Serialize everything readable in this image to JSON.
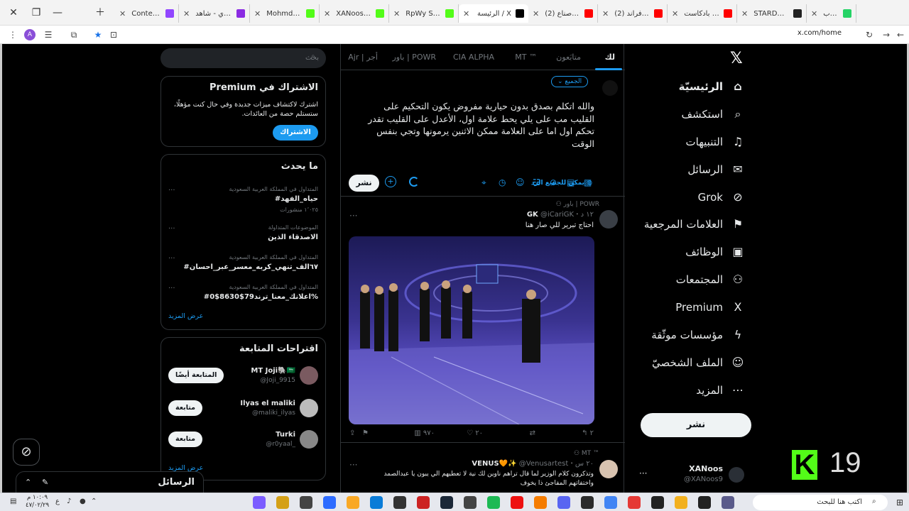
{
  "browser": {
    "tabs": [
      {
        "label": "واتساب",
        "color": "#25d366"
      },
      {
        "label": "STARDOM UN",
        "color": "#222222"
      },
      {
        "label": "للي بادكاست",
        "color": "#ff0000"
      },
      {
        "label": "(2) اغنية فراند",
        "color": "#ff0000"
      },
      {
        "label": "(2) دوري صناع",
        "color": "#ff0000"
      },
      {
        "label": "الرئيسة / X",
        "color": "#000000"
      },
      {
        "label": "RpWy Stream",
        "color": "#53fc18"
      },
      {
        "label": "XANoos Strea",
        "color": "#53fc18"
      },
      {
        "label": "Mohmdi12 Str",
        "color": "#53fc18"
      },
      {
        "label": "نوريلاي - شاهد",
        "color": "#8a2be2"
      },
      {
        "label": "ContentCreato",
        "color": "#9146ff"
      }
    ],
    "url": "x.com/home",
    "profile_letter": "A"
  },
  "sidebar": {
    "items": [
      {
        "label": "الرئيسيّة",
        "icon": "home-icon",
        "glyph": "⌂"
      },
      {
        "label": "استكشف",
        "icon": "search-icon",
        "glyph": "⌕"
      },
      {
        "label": "التنبيهات",
        "icon": "bell-icon",
        "glyph": "♫"
      },
      {
        "label": "الرسائل",
        "icon": "mail-icon",
        "glyph": "✉"
      },
      {
        "label": "Grok",
        "icon": "grok-icon",
        "glyph": "⊘"
      },
      {
        "label": "العلامات المرجعية",
        "icon": "bookmark-icon",
        "glyph": "⚑"
      },
      {
        "label": "الوظائف",
        "icon": "briefcase-icon",
        "glyph": "▣"
      },
      {
        "label": "المجتمعات",
        "icon": "communities-icon",
        "glyph": "⚇"
      },
      {
        "label": "Premium",
        "icon": "x-logo-icon",
        "glyph": "X"
      },
      {
        "label": "مؤسسات موثّقة",
        "icon": "lightning-icon",
        "glyph": "ϟ"
      },
      {
        "label": "الملف الشخصيّ",
        "icon": "person-icon",
        "glyph": "☺"
      },
      {
        "label": "المزيد",
        "icon": "more-circle-icon",
        "glyph": "⋯"
      }
    ],
    "post_label": "نشر",
    "profile": {
      "name": "XANoos",
      "handle": "@XANoos9"
    }
  },
  "overlay": {
    "kick_letter": "K",
    "kick_number": "19"
  },
  "timeline": {
    "tabs": [
      "لك",
      "متابَعون",
      "MT ™",
      "CIA ALPHA",
      "باور | POWR",
      "Ajr | أجر"
    ],
    "composer": {
      "audience": "الجميع",
      "text": "والله اتكلم بصدق بدون حيارية مفروض يكون التحكيم على القليب مب على يلي يحط علامة اول، الأعدل على القليب تقدر تحكم اول اما على العلامة ممكن الاثنين يرمونها وتجي بنفس الوقت",
      "reply_setting": "يمكن للجميع الرد",
      "post_label": "نشر"
    },
    "tweets": [
      {
        "community": "باور | POWR",
        "name": "GK",
        "handle": "@iCariGK",
        "time": "١٢ د",
        "text": "احتاج تبرير للي صار هنا",
        "replies": "٢",
        "likes": "٢٠",
        "views": "٩٧٠"
      },
      {
        "community": "MT ™",
        "name": "VENUS🧡✨",
        "handle": "@Venusartest",
        "time": "٢٠ س",
        "line1": "وتذكرون كلام الوزير لما قال تراهم ناوين لك نية لا تعطيهم الي يبون يا عبدالصمد",
        "line2": "واختفاتهم المفاجئ ذا يخوف"
      }
    ]
  },
  "right": {
    "search_placeholder": "بحث",
    "premium": {
      "title": "Premium الاشتراك في",
      "text": "اشترك لاكتشاف ميزات جديدة وفي حال كنت مؤهلًا، ستستلم حصة من العائدات.",
      "button": "الاشتراك"
    },
    "trends": {
      "title": "ما يحدث",
      "items": [
        {
          "context": "المتداول في المملكة العربية السعودية",
          "name": "#حياه_الفهد",
          "count": "١٬٠٢٥ منشورات"
        },
        {
          "context": "الموضوعات المتداولة",
          "name": "الاصدقاء الذين",
          "count": ""
        },
        {
          "context": "المتداول في المملكة العربية السعودية",
          "name": "#٦٧الف_تنهي_كربه_معسر_عبر_احسان",
          "count": ""
        },
        {
          "context": "المتداول في المملكة العربية السعودية",
          "name": "#اعلانك_معنا_ترند79$8630$0%",
          "count": ""
        }
      ],
      "more": "عرض المزيد"
    },
    "who": {
      "title": "اقتراحات المتابعة",
      "items": [
        {
          "name": "MT Joji🐘🇸🇦",
          "handle": "@Joji_9915",
          "button": "المتابعة أيضًا"
        },
        {
          "name": "Ilyas el maliki",
          "handle": "@maliki_ilyas",
          "button": "متابعة"
        },
        {
          "name": "Turki",
          "handle": "@r0yaal_",
          "button": "متابعة"
        }
      ],
      "more": "عرض المزيد"
    }
  },
  "messages_dock": {
    "title": "الرسائل"
  },
  "taskbar": {
    "search_text": "اكتب هنا للبحث",
    "time": "١٠:٠٩ م",
    "date": "٤٧/٠٢/٢٩",
    "lang": "ع"
  }
}
